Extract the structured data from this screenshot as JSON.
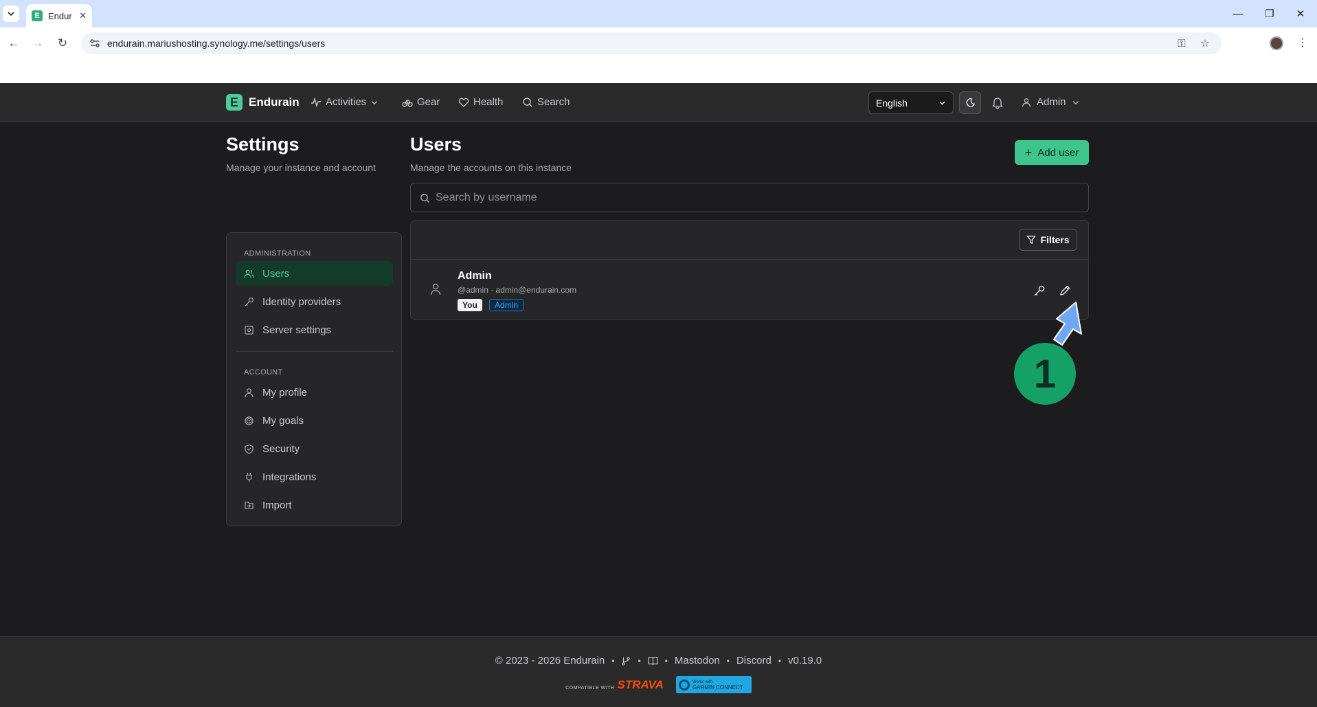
{
  "browser": {
    "tab_title": "Endur",
    "tab_favicon_letter": "E",
    "url": "endurain.mariushosting.synology.me/settings/users"
  },
  "header": {
    "brand": "Endurain",
    "brand_logo_letter": "E",
    "nav": {
      "activities": "Activities",
      "gear": "Gear",
      "health": "Health",
      "search": "Search"
    },
    "language": "English",
    "user": "Admin"
  },
  "settings": {
    "title": "Settings",
    "subtitle": "Manage your instance and account",
    "sections": [
      {
        "label": "ADMINISTRATION",
        "items": [
          {
            "label": "Users",
            "icon": "users-icon",
            "active": true
          },
          {
            "label": "Identity providers",
            "icon": "key-icon"
          },
          {
            "label": "Server settings",
            "icon": "server-icon"
          }
        ]
      },
      {
        "label": "ACCOUNT",
        "items": [
          {
            "label": "My profile",
            "icon": "user-icon"
          },
          {
            "label": "My goals",
            "icon": "target-icon"
          },
          {
            "label": "Security",
            "icon": "shield-icon"
          },
          {
            "label": "Integrations",
            "icon": "plug-icon"
          },
          {
            "label": "Import",
            "icon": "import-icon"
          }
        ]
      }
    ]
  },
  "users": {
    "title": "Users",
    "subtitle": "Manage the accounts on this instance",
    "add_button": "Add user",
    "search_placeholder": "Search by username",
    "filters_button": "Filters",
    "rows": [
      {
        "name": "Admin",
        "meta": "@admin · admin@endurain.com",
        "badges": [
          "You",
          "Admin"
        ]
      }
    ]
  },
  "annotation": {
    "step": "1"
  },
  "footer": {
    "copyright": "© 2023 - 2026 Endurain",
    "mastodon": "Mastodon",
    "discord": "Discord",
    "version": "v0.19.0",
    "strava_small": "COMPATIBLE WITH",
    "strava_big": "STRAVA",
    "garmin_line1": "Works with",
    "garmin_line2": "GARMIN CONNECT"
  },
  "colors": {
    "accent": "#3ec58e",
    "background": "#1c1c1e",
    "panel": "#262628",
    "annotation_arrow": "#6ea8f5",
    "annotation_circle": "#15a067"
  }
}
